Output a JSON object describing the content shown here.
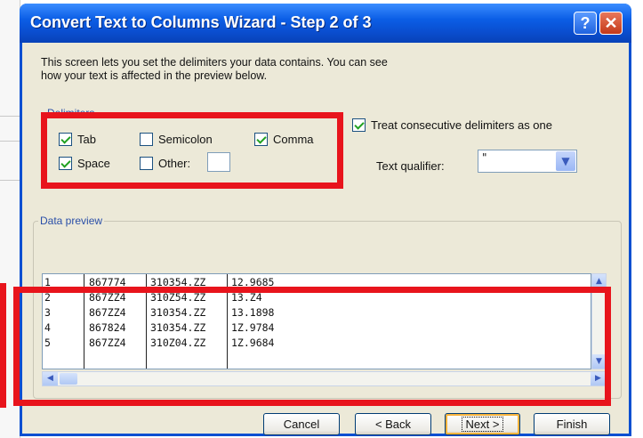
{
  "dialog": {
    "title": "Convert Text to Columns Wizard - Step 2 of 3",
    "help_label": "?",
    "close_label": "✕",
    "intro_line1": "This screen lets you set the delimiters your data contains.  You can see",
    "intro_line2": "how your text is affected in the preview below."
  },
  "delimiters": {
    "group_label": "Delimiters",
    "tab": {
      "label": "Tab",
      "checked": true
    },
    "semicolon": {
      "label": "Semicolon",
      "checked": false
    },
    "comma": {
      "label": "Comma",
      "checked": true
    },
    "space": {
      "label": "Space",
      "checked": true
    },
    "other": {
      "label": "Other:",
      "checked": false,
      "value": ""
    }
  },
  "consecutive": {
    "label": "Treat consecutive delimiters as one",
    "checked": true
  },
  "qualifier": {
    "label": "Text qualifier:",
    "value": "\""
  },
  "preview": {
    "group_label": "Data preview",
    "rows": [
      [
        "1",
        "867774",
        "310354.ZZ",
        "12.9685"
      ],
      [
        "2",
        "867ZZ4",
        "310Z54.ZZ",
        "13.Z4"
      ],
      [
        "3",
        "867ZZ4",
        "310354.ZZ",
        "13.1898"
      ],
      [
        "4",
        "867824",
        "310354.ZZ",
        "1Z.9784"
      ],
      [
        "5",
        "867ZZ4",
        "310Z04.ZZ",
        "1Z.9684"
      ]
    ]
  },
  "buttons": {
    "cancel": "Cancel",
    "back": "< Back",
    "next": "Next >",
    "finish": "Finish"
  },
  "colors": {
    "highlight": "#e8141c",
    "titlebar": "#0a4fd1",
    "dialog_bg": "#ece9d8"
  }
}
